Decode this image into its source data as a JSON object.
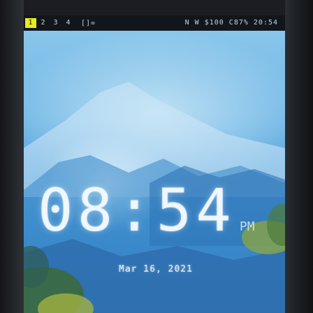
{
  "status_bar": {
    "workspaces": [
      "1",
      "2",
      "3",
      "4"
    ],
    "active_workspace": "1",
    "layout_tag": "[]=",
    "right_text": "N W $100 C87% 20:54"
  },
  "lockscreen": {
    "time": "08:54",
    "ampm": "PM",
    "date": "Mar 16, 2021"
  }
}
